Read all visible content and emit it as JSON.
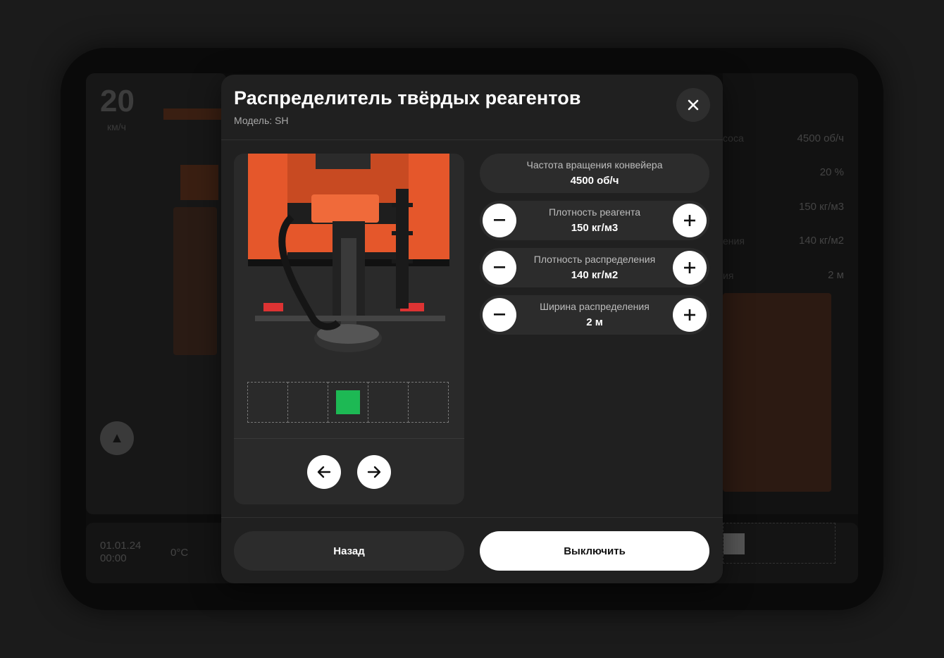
{
  "background": {
    "speed_value": "20",
    "speed_unit": "км/ч",
    "date": "01.01.24",
    "time": "00:00",
    "temperature": "0°C",
    "rows": [
      {
        "label": "соса",
        "value": "4500 об/ч"
      },
      {
        "label": "",
        "value": "20 %"
      },
      {
        "label": "",
        "value": "150 кг/м3"
      },
      {
        "label": "ения",
        "value": "140 кг/м2"
      },
      {
        "label": "ия",
        "value": "2 м"
      }
    ]
  },
  "modal": {
    "title": "Распределитель твёрдых реагентов",
    "subtitle": "Модель: SH",
    "close_icon": "close-icon",
    "slots_active_index": 2,
    "params": [
      {
        "label": "Частота вращения конвейера",
        "value": "4500 об/ч",
        "adjustable": false
      },
      {
        "label": "Плотность реагента",
        "value": "150 кг/м3",
        "adjustable": true
      },
      {
        "label": "Плотность распределения",
        "value": "140 кг/м2",
        "adjustable": true
      },
      {
        "label": "Ширина распределения",
        "value": "2 м",
        "adjustable": true
      }
    ],
    "back_label": "Назад",
    "off_label": "Выключить"
  },
  "colors": {
    "accent_green": "#1db954",
    "truck_orange": "#e5572b"
  }
}
